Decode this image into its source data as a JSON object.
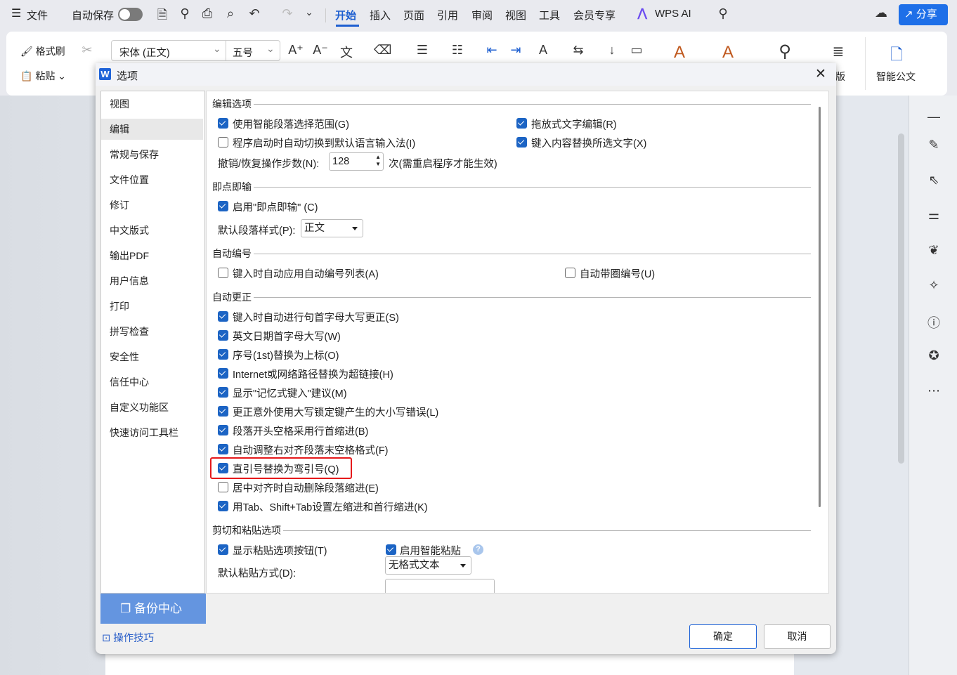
{
  "topbar": {
    "menu": "文件",
    "autosave": "自动保存",
    "tabs": [
      "开始",
      "插入",
      "页面",
      "引用",
      "审阅",
      "视图",
      "工具",
      "会员专享"
    ],
    "active_tab": "开始",
    "wps_ai": "WPS AI",
    "share": "分享",
    "accent": "#1e6fe8"
  },
  "ribbon": {
    "format_painter": "格式刷",
    "paste": "粘贴",
    "font": "宋体 (正文)",
    "size": "五号",
    "layout_partial": "版",
    "smart_doc": "智能公文"
  },
  "dialog": {
    "title": "选项",
    "nav": [
      "视图",
      "编辑",
      "常规与保存",
      "文件位置",
      "修订",
      "中文版式",
      "输出PDF",
      "用户信息",
      "打印",
      "拼写检查",
      "安全性",
      "信任中心",
      "自定义功能区",
      "快速访问工具栏"
    ],
    "nav_selected": "编辑",
    "backup": "备份中心",
    "tips": "操作技巧",
    "ok": "确定",
    "cancel": "取消",
    "sections": {
      "edit": {
        "title": "编辑选项",
        "smart_para": {
          "label": "使用智能段落选择范围(G)",
          "checked": true
        },
        "auto_ime": {
          "label": "程序启动时自动切换到默认语言输入法(I)",
          "checked": false
        },
        "drag_edit": {
          "label": "拖放式文字编辑(R)",
          "checked": true
        },
        "replace_sel": {
          "label": "键入内容替换所选文字(X)",
          "checked": true
        },
        "undo_label": "撤销/恢复操作步数(N):",
        "undo_value": "128",
        "undo_note": "次(需重启程序才能生效)"
      },
      "click_type": {
        "title": "即点即输",
        "enable": {
          "label": "启用\"即点即输\" (C)",
          "checked": true
        },
        "style_label": "默认段落样式(P):",
        "style_value": "正文"
      },
      "auto_number": {
        "title": "自动编号",
        "auto_list": {
          "label": "键入时自动应用自动编号列表(A)",
          "checked": false
        },
        "circle": {
          "label": "自动带圈编号(U)",
          "checked": false
        }
      },
      "autocorrect": {
        "title": "自动更正",
        "items": [
          {
            "label": "键入时自动进行句首字母大写更正(S)",
            "checked": true
          },
          {
            "label": "英文日期首字母大写(W)",
            "checked": true
          },
          {
            "label": "序号(1st)替换为上标(O)",
            "checked": true
          },
          {
            "label": "Internet或网络路径替换为超链接(H)",
            "checked": true
          },
          {
            "label": "显示\"记忆式键入\"建议(M)",
            "checked": true
          },
          {
            "label": "更正意外使用大写锁定键产生的大小写错误(L)",
            "checked": true
          },
          {
            "label": "段落开头空格采用行首缩进(B)",
            "checked": true
          },
          {
            "label": "自动调整右对齐段落末空格格式(F)",
            "checked": true
          },
          {
            "label": "直引号替换为弯引号(Q)",
            "checked": true,
            "highlighted": true
          },
          {
            "label": "居中对齐时自动删除段落缩进(E)",
            "checked": false
          },
          {
            "label": "用Tab、Shift+Tab设置左缩进和首行缩进(K)",
            "checked": true
          }
        ]
      },
      "paste": {
        "title": "剪切和粘贴选项",
        "show_btn": {
          "label": "显示粘贴选项按钮(T)",
          "checked": true
        },
        "smart": {
          "label": "启用智能粘贴",
          "checked": true
        },
        "default_label": "默认粘贴方式(D):",
        "default_value": "无格式文本"
      }
    }
  }
}
